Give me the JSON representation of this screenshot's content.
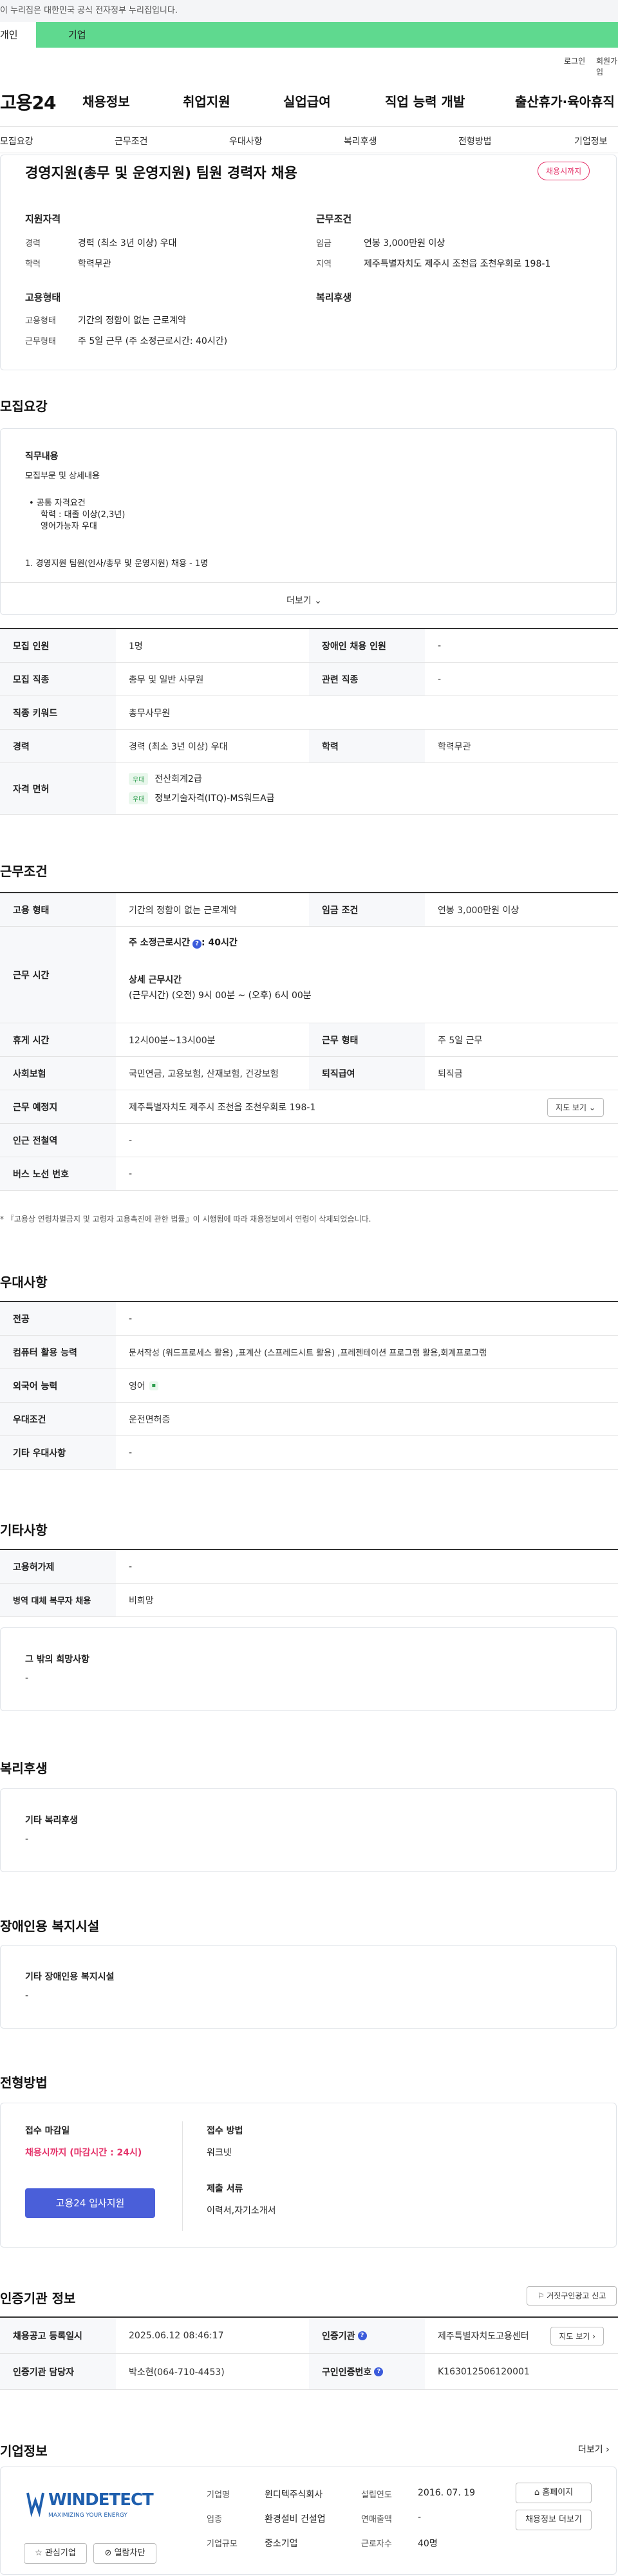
{
  "notice": "이 누리집은 대한민국 공식 전자정부 누리집입니다.",
  "tabs": {
    "individual": "개인",
    "corporate": "기업"
  },
  "util": {
    "login": "로그인",
    "signup": "회원가입"
  },
  "logo": "고용24",
  "gnb": [
    "채용정보",
    "취업지원",
    "실업급여",
    "직업 능력 개발",
    "출산휴가·육아휴직"
  ],
  "snb": [
    "모집요강",
    "근무조건",
    "우대사항",
    "복리후생",
    "전형방법",
    "기업정보"
  ],
  "summary": {
    "title": "경영지원(총무 및 운영지원) 팀원 경력자 채용",
    "badge": "채용시까지",
    "qual_title": "지원자격",
    "career_label": "경력",
    "career_value": "경력 (최소 3년 이상) 우대",
    "edu_label": "학력",
    "edu_value": "학력무관",
    "cond_title": "근무조건",
    "wage_label": "임금",
    "wage_value": "연봉 3,000만원 이상",
    "region_label": "지역",
    "region_value": "제주특별자치도 제주시 조천읍 조천우회로 198-1",
    "emp_title": "고용형태",
    "emp_type_label": "고용형태",
    "emp_type_value": "기간의 정함이 없는 근로계약",
    "work_label": "근무형태",
    "work_value": "주 5일 근무 (주 소정근로시간: 40시간)",
    "welfare_title": "복리후생"
  },
  "recruit": {
    "title": "모집요강",
    "duty_title": "직무내용",
    "duty_sub": "모집부문 및 상세내용",
    "duty_lines": [
      "• 공통 자격요건",
      "학력 : 대졸 이상(2,3년)",
      "영어가능자 우대"
    ],
    "duty_item": "1. 경영지원 팀원(인사/총무 및 운영지원) 채용 - 1명",
    "more": "더보기",
    "rows": {
      "headcount_label": "모집 인원",
      "headcount": "1명",
      "disabled_label": "장애인 채용 인원",
      "disabled": "-",
      "job_label": "모집 직종",
      "job": "총무 및 일반 사무원",
      "related_label": "관련 직종",
      "related": "-",
      "keyword_label": "직종 키워드",
      "keyword": "총무사무원",
      "career_label": "경력",
      "career": "경력 (최소 3년 이상) 우대",
      "edu_label": "학력",
      "edu": "학력무관",
      "license_label": "자격 면허",
      "license_chip": "우대",
      "licenses": [
        "전산회계2급",
        "정보기술자격(ITQ)-MS워드A급"
      ]
    }
  },
  "conditions": {
    "title": "근무조건",
    "emp_label": "고용 형태",
    "emp": "기간의 정함이 없는 근로계약",
    "wage_label": "임금 조건",
    "wage": "연봉 3,000만원 이상",
    "hours_label": "근무 시간",
    "hours_weekly": "주 소정근로시간",
    "hours_weekly_val": ": 40시간",
    "hours_detail_title": "상세 근무시간",
    "hours_detail": "(근무시간) (오전) 9시 00분 ~ (오후) 6시 00분",
    "break_label": "휴게 시간",
    "break": "12시00분~13시00분",
    "worktype_label": "근무 형태",
    "worktype": "주 5일 근무",
    "insurance_label": "사회보험",
    "insurance": "국민연금, 고용보험, 산재보험, 건강보험",
    "severance_label": "퇴직급여",
    "severance": "퇴직금",
    "place_label": "근무 예정지",
    "place": "제주특별자치도 제주시 조천읍 조천우회로 198-1",
    "map_btn": "지도 보기",
    "station_label": "인근 전철역",
    "station": "-",
    "bus_label": "버스 노선 번호",
    "bus": "-",
    "note": "* 『고용상 연령차별금지 및 고령자 고용촉진에 관한 법률』이 시행됨에 따라 채용정보에서 연령이 삭제되었습니다."
  },
  "preference": {
    "title": "우대사항",
    "major_label": "전공",
    "major": "-",
    "computer_label": "컴퓨터 활용 능력",
    "computer": "문서작성 (워드프로세스 활용) ,표계산 (스프레드시트 활용) ,프레젠테이션 프로그램 활용,회계프로그램",
    "lang_label": "외국어 능력",
    "lang": "영어",
    "cond_label": "우대조건",
    "cond": "운전면허증",
    "etc_label": "기타 우대사항",
    "etc": "-"
  },
  "etc": {
    "title": "기타사항",
    "ins_label": "고용허가제",
    "ins": "-",
    "military_label": "병역 대체 복무자 채용",
    "military": "비희망",
    "wish_title": "그 밖의 희망사항",
    "wish": "-"
  },
  "welfare": {
    "title": "복리후생",
    "sub": "기타 복리후생",
    "val": "-"
  },
  "facility": {
    "title": "장애인용 복지시설",
    "sub": "기타 장애인용 복지시설",
    "val": "-"
  },
  "screening": {
    "title": "전형방법",
    "deadline_title": "접수 마감일",
    "deadline": "채용시까지 (마감시간 : 24시)",
    "apply_btn": "고용24 입사지원",
    "method_title": "접수 방법",
    "method": "워크넷",
    "docs_title": "제출 서류",
    "docs": "이력서,자기소개서"
  },
  "agency": {
    "title": "인증기관 정보",
    "report_btn": "거짓구인광고 신고",
    "regdate_label": "채용공고 등록일시",
    "regdate": "2025.06.12 08:46:17",
    "agency_label": "인증기관",
    "agency": "제주특별자치도고용센터",
    "map_btn": "지도 보기",
    "manager_label": "인증기관 담당자",
    "manager": "박소현(064-710-4453)",
    "reqno_label": "구인인증번호",
    "reqno": "K163012506120001"
  },
  "company": {
    "title": "기업정보",
    "more": "더보기",
    "logo_text": "WINDETECT",
    "logo_tag": "MAXIMIZING YOUR ENERGY",
    "name_label": "기업명",
    "name": "윈디텍주식회사",
    "est_label": "설립연도",
    "est": "2016. 07. 19",
    "biz_label": "업종",
    "biz": "환경설비 건설업",
    "sales_label": "연매출액",
    "sales": "-",
    "size_label": "기업규모",
    "size": "중소기업",
    "emp_label": "근로자수",
    "emp": "40명",
    "homepage_btn": "홈페이지",
    "jobs_btn": "채용정보 더보기",
    "fav_btn": "관심기업",
    "block_btn": "열람차단"
  },
  "colors": {
    "accent": "#4a5fd9",
    "green": "#5fd98f",
    "red": "#e5336a"
  }
}
